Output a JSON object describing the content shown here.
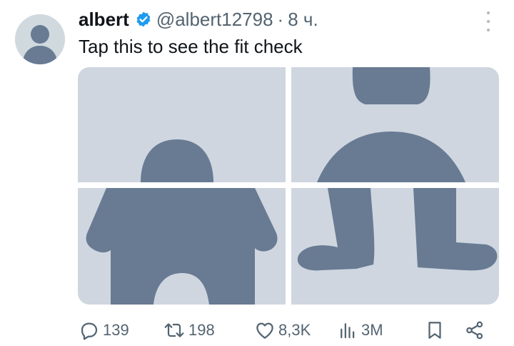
{
  "tweet": {
    "author_name": "albert",
    "handle": "@albert12798",
    "separator": "·",
    "time": "8 ч.",
    "text": "Tap this to see the fit check",
    "verified": true
  },
  "actions": {
    "replies": "139",
    "reposts": "198",
    "likes": "8,3K",
    "views": "3M"
  },
  "icons": {
    "avatar": "default-avatar-silhouette",
    "verified": "verified-badge-icon",
    "more": "more-options-icon",
    "reply": "reply-icon",
    "repost": "repost-icon",
    "like": "like-heart-icon",
    "views": "views-bar-chart-icon",
    "bookmark": "bookmark-icon",
    "share": "share-icon"
  },
  "colors": {
    "silhouette_bg": "#cfd6e0",
    "silhouette_fg": "#687b93",
    "verified": "#1d9bf0",
    "muted": "#536471"
  }
}
